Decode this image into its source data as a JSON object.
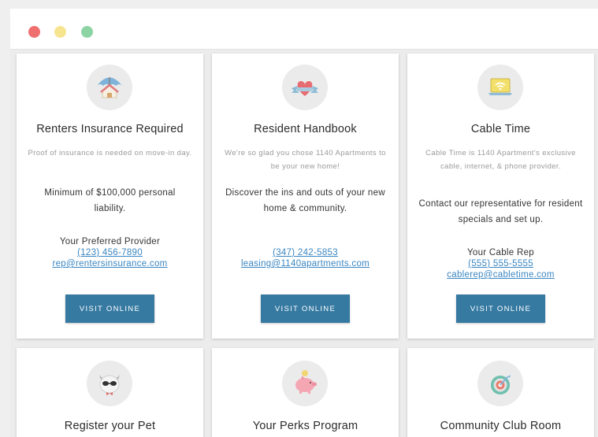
{
  "window": {
    "controls": [
      "close",
      "minimize",
      "maximize"
    ],
    "colors": {
      "close": "#ef6f6f",
      "minimize": "#f7e48f",
      "maximize": "#8cd4a3"
    }
  },
  "accent": "#367aa2",
  "link_color": "#3a86c2",
  "cards": [
    {
      "icon": "umbrella-house-icon",
      "title": "Renters Insurance Required",
      "description": "Proof of insurance is needed on move-in day.",
      "body": "Minimum of $100,000 personal liability.",
      "contact_label": "Your Preferred Provider",
      "phone": "(123) 456-7890",
      "email": "rep@rentersinsurance.com",
      "button": "VISIT ONLINE"
    },
    {
      "icon": "heart-ribbon-icon",
      "title": "Resident Handbook",
      "description": "We're so glad you chose 1140 Apartments to be your new home!",
      "body": "Discover the ins and outs of your new home & community.",
      "contact_label": "",
      "phone": "(347) 242-5853",
      "email": "leasing@1140apartments.com",
      "button": "VISIT ONLINE"
    },
    {
      "icon": "wifi-laptop-icon",
      "title": "Cable Time",
      "description": "Cable Time is 1140 Apartment's exclusive cable, internet, & phone provider.",
      "body": "Contact our representative for resident specials and set up.",
      "contact_label": "Your Cable Rep",
      "phone": "(555) 555-5555",
      "email": "cablerep@cabletime.com",
      "button": "VISIT ONLINE"
    },
    {
      "icon": "pet-dog-sunglasses-icon",
      "title": "Register your Pet"
    },
    {
      "icon": "piggy-bank-icon",
      "title": "Your Perks Program"
    },
    {
      "icon": "target-club-icon",
      "title": "Community Club Room"
    }
  ]
}
